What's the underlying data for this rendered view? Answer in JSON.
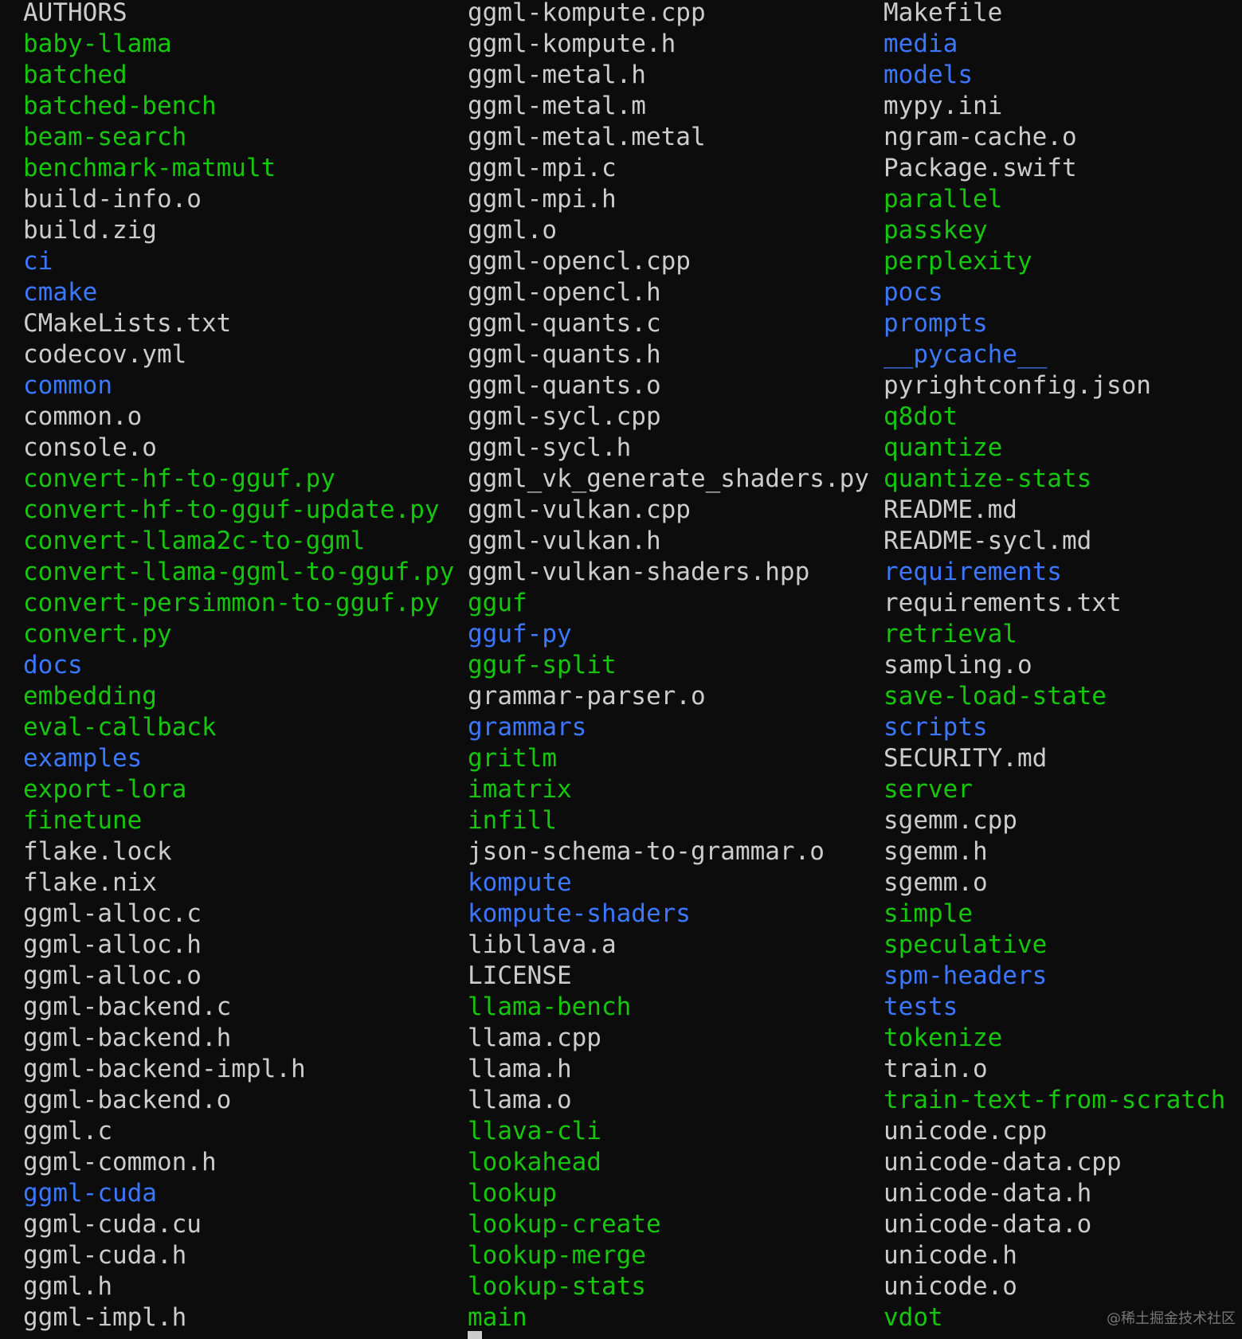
{
  "colors": {
    "background": "#0c0c0c",
    "file": "#cccccc",
    "executable": "#16c60c",
    "directory": "#3b78ff"
  },
  "listing": {
    "columns": [
      [
        {
          "name": "AUTHORS",
          "kind": "file"
        },
        {
          "name": "baby-llama",
          "kind": "exec"
        },
        {
          "name": "batched",
          "kind": "exec"
        },
        {
          "name": "batched-bench",
          "kind": "exec"
        },
        {
          "name": "beam-search",
          "kind": "exec"
        },
        {
          "name": "benchmark-matmult",
          "kind": "exec"
        },
        {
          "name": "build-info.o",
          "kind": "file"
        },
        {
          "name": "build.zig",
          "kind": "file"
        },
        {
          "name": "ci",
          "kind": "dir"
        },
        {
          "name": "cmake",
          "kind": "dir"
        },
        {
          "name": "CMakeLists.txt",
          "kind": "file"
        },
        {
          "name": "codecov.yml",
          "kind": "file"
        },
        {
          "name": "common",
          "kind": "dir"
        },
        {
          "name": "common.o",
          "kind": "file"
        },
        {
          "name": "console.o",
          "kind": "file"
        },
        {
          "name": "convert-hf-to-gguf.py",
          "kind": "exec"
        },
        {
          "name": "convert-hf-to-gguf-update.py",
          "kind": "exec"
        },
        {
          "name": "convert-llama2c-to-ggml",
          "kind": "exec"
        },
        {
          "name": "convert-llama-ggml-to-gguf.py",
          "kind": "exec"
        },
        {
          "name": "convert-persimmon-to-gguf.py",
          "kind": "exec"
        },
        {
          "name": "convert.py",
          "kind": "exec"
        },
        {
          "name": "docs",
          "kind": "dir"
        },
        {
          "name": "embedding",
          "kind": "exec"
        },
        {
          "name": "eval-callback",
          "kind": "exec"
        },
        {
          "name": "examples",
          "kind": "dir"
        },
        {
          "name": "export-lora",
          "kind": "exec"
        },
        {
          "name": "finetune",
          "kind": "exec"
        },
        {
          "name": "flake.lock",
          "kind": "file"
        },
        {
          "name": "flake.nix",
          "kind": "file"
        },
        {
          "name": "ggml-alloc.c",
          "kind": "file"
        },
        {
          "name": "ggml-alloc.h",
          "kind": "file"
        },
        {
          "name": "ggml-alloc.o",
          "kind": "file"
        },
        {
          "name": "ggml-backend.c",
          "kind": "file"
        },
        {
          "name": "ggml-backend.h",
          "kind": "file"
        },
        {
          "name": "ggml-backend-impl.h",
          "kind": "file"
        },
        {
          "name": "ggml-backend.o",
          "kind": "file"
        },
        {
          "name": "ggml.c",
          "kind": "file"
        },
        {
          "name": "ggml-common.h",
          "kind": "file"
        },
        {
          "name": "ggml-cuda",
          "kind": "dir"
        },
        {
          "name": "ggml-cuda.cu",
          "kind": "file"
        },
        {
          "name": "ggml-cuda.h",
          "kind": "file"
        },
        {
          "name": "ggml.h",
          "kind": "file"
        },
        {
          "name": "ggml-impl.h",
          "kind": "file"
        }
      ],
      [
        {
          "name": "ggml-kompute.cpp",
          "kind": "file"
        },
        {
          "name": "ggml-kompute.h",
          "kind": "file"
        },
        {
          "name": "ggml-metal.h",
          "kind": "file"
        },
        {
          "name": "ggml-metal.m",
          "kind": "file"
        },
        {
          "name": "ggml-metal.metal",
          "kind": "file"
        },
        {
          "name": "ggml-mpi.c",
          "kind": "file"
        },
        {
          "name": "ggml-mpi.h",
          "kind": "file"
        },
        {
          "name": "ggml.o",
          "kind": "file"
        },
        {
          "name": "ggml-opencl.cpp",
          "kind": "file"
        },
        {
          "name": "ggml-opencl.h",
          "kind": "file"
        },
        {
          "name": "ggml-quants.c",
          "kind": "file"
        },
        {
          "name": "ggml-quants.h",
          "kind": "file"
        },
        {
          "name": "ggml-quants.o",
          "kind": "file"
        },
        {
          "name": "ggml-sycl.cpp",
          "kind": "file"
        },
        {
          "name": "ggml-sycl.h",
          "kind": "file"
        },
        {
          "name": "ggml_vk_generate_shaders.py",
          "kind": "file"
        },
        {
          "name": "ggml-vulkan.cpp",
          "kind": "file"
        },
        {
          "name": "ggml-vulkan.h",
          "kind": "file"
        },
        {
          "name": "ggml-vulkan-shaders.hpp",
          "kind": "file"
        },
        {
          "name": "gguf",
          "kind": "exec"
        },
        {
          "name": "gguf-py",
          "kind": "dir"
        },
        {
          "name": "gguf-split",
          "kind": "exec"
        },
        {
          "name": "grammar-parser.o",
          "kind": "file"
        },
        {
          "name": "grammars",
          "kind": "dir"
        },
        {
          "name": "gritlm",
          "kind": "exec"
        },
        {
          "name": "imatrix",
          "kind": "exec"
        },
        {
          "name": "infill",
          "kind": "exec"
        },
        {
          "name": "json-schema-to-grammar.o",
          "kind": "file"
        },
        {
          "name": "kompute",
          "kind": "dir"
        },
        {
          "name": "kompute-shaders",
          "kind": "dir"
        },
        {
          "name": "libllava.a",
          "kind": "file"
        },
        {
          "name": "LICENSE",
          "kind": "file"
        },
        {
          "name": "llama-bench",
          "kind": "exec"
        },
        {
          "name": "llama.cpp",
          "kind": "file"
        },
        {
          "name": "llama.h",
          "kind": "file"
        },
        {
          "name": "llama.o",
          "kind": "file"
        },
        {
          "name": "llava-cli",
          "kind": "exec"
        },
        {
          "name": "lookahead",
          "kind": "exec"
        },
        {
          "name": "lookup",
          "kind": "exec"
        },
        {
          "name": "lookup-create",
          "kind": "exec"
        },
        {
          "name": "lookup-merge",
          "kind": "exec"
        },
        {
          "name": "lookup-stats",
          "kind": "exec"
        },
        {
          "name": "main",
          "kind": "exec"
        }
      ],
      [
        {
          "name": "Makefile",
          "kind": "file"
        },
        {
          "name": "media",
          "kind": "dir"
        },
        {
          "name": "models",
          "kind": "dir"
        },
        {
          "name": "mypy.ini",
          "kind": "file"
        },
        {
          "name": "ngram-cache.o",
          "kind": "file"
        },
        {
          "name": "Package.swift",
          "kind": "file"
        },
        {
          "name": "parallel",
          "kind": "exec"
        },
        {
          "name": "passkey",
          "kind": "exec"
        },
        {
          "name": "perplexity",
          "kind": "exec"
        },
        {
          "name": "pocs",
          "kind": "dir"
        },
        {
          "name": "prompts",
          "kind": "dir"
        },
        {
          "name": "__pycache__",
          "kind": "dir"
        },
        {
          "name": "pyrightconfig.json",
          "kind": "file"
        },
        {
          "name": "q8dot",
          "kind": "exec"
        },
        {
          "name": "quantize",
          "kind": "exec"
        },
        {
          "name": "quantize-stats",
          "kind": "exec"
        },
        {
          "name": "README.md",
          "kind": "file"
        },
        {
          "name": "README-sycl.md",
          "kind": "file"
        },
        {
          "name": "requirements",
          "kind": "dir"
        },
        {
          "name": "requirements.txt",
          "kind": "file"
        },
        {
          "name": "retrieval",
          "kind": "exec"
        },
        {
          "name": "sampling.o",
          "kind": "file"
        },
        {
          "name": "save-load-state",
          "kind": "exec"
        },
        {
          "name": "scripts",
          "kind": "dir"
        },
        {
          "name": "SECURITY.md",
          "kind": "file"
        },
        {
          "name": "server",
          "kind": "exec"
        },
        {
          "name": "sgemm.cpp",
          "kind": "file"
        },
        {
          "name": "sgemm.h",
          "kind": "file"
        },
        {
          "name": "sgemm.o",
          "kind": "file"
        },
        {
          "name": "simple",
          "kind": "exec"
        },
        {
          "name": "speculative",
          "kind": "exec"
        },
        {
          "name": "spm-headers",
          "kind": "dir"
        },
        {
          "name": "tests",
          "kind": "dir"
        },
        {
          "name": "tokenize",
          "kind": "exec"
        },
        {
          "name": "train.o",
          "kind": "file"
        },
        {
          "name": "train-text-from-scratch",
          "kind": "exec"
        },
        {
          "name": "unicode.cpp",
          "kind": "file"
        },
        {
          "name": "unicode-data.cpp",
          "kind": "file"
        },
        {
          "name": "unicode-data.h",
          "kind": "file"
        },
        {
          "name": "unicode-data.o",
          "kind": "file"
        },
        {
          "name": "unicode.h",
          "kind": "file"
        },
        {
          "name": "unicode.o",
          "kind": "file"
        },
        {
          "name": "vdot",
          "kind": "exec"
        }
      ]
    ]
  },
  "watermark": "@稀土掘金技术社区"
}
